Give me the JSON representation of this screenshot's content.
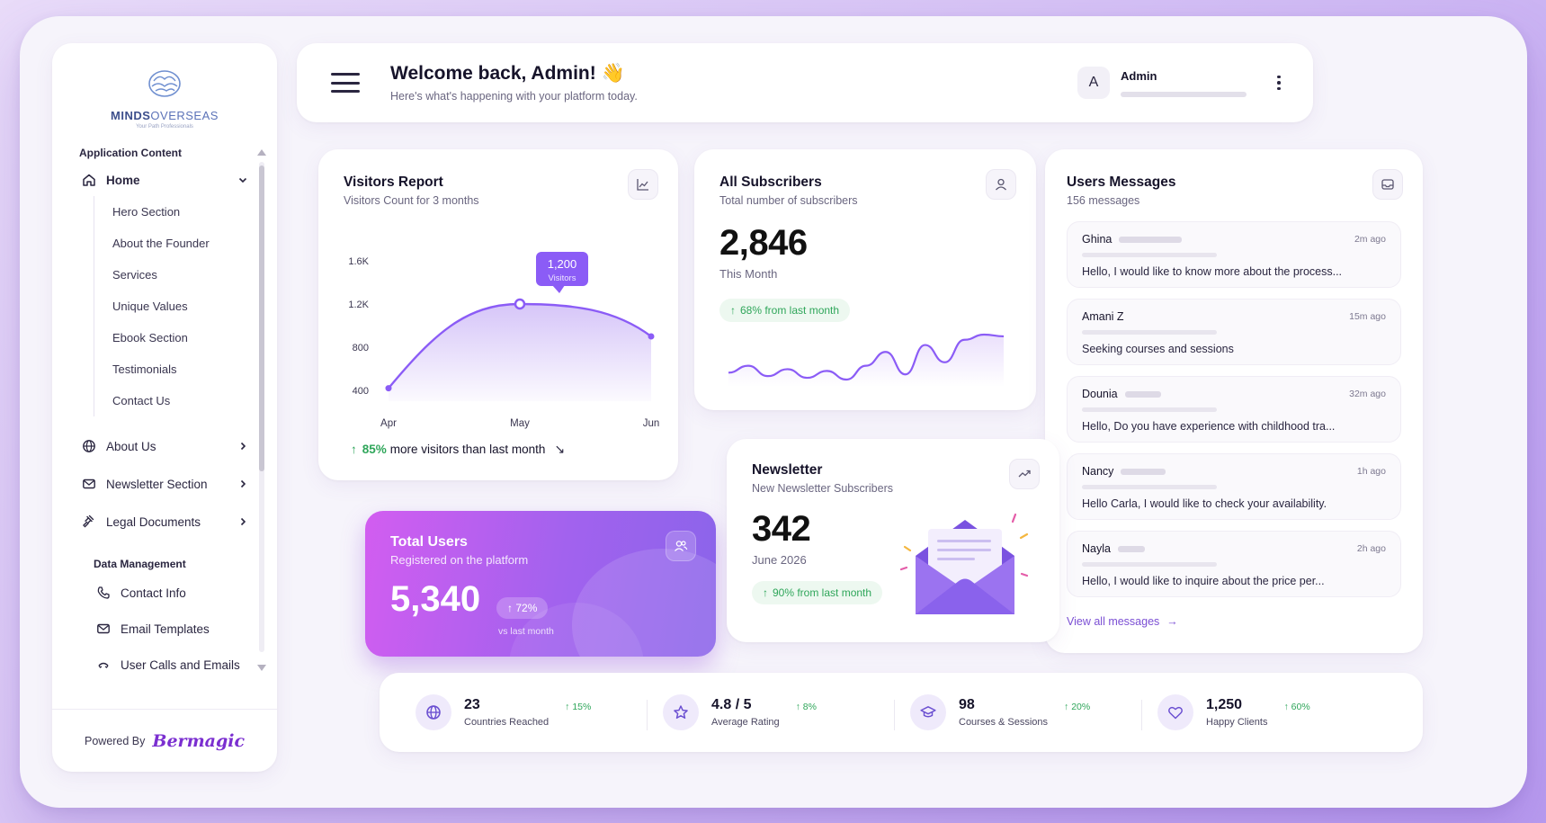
{
  "brand": {
    "name_part1": "MINDS",
    "name_part2": "OVERSEAS",
    "tagline": "Your Path Professionals"
  },
  "sidebar": {
    "section1_title": "Application Content",
    "home": {
      "label": "Home",
      "icon": "home-icon"
    },
    "home_children": [
      "Hero Section",
      "About the Founder",
      "Services",
      "Unique Values",
      "Ebook Section",
      "Testimonials",
      "Contact Us"
    ],
    "items": [
      {
        "label": "About Us",
        "icon": "globe-icon"
      },
      {
        "label": "Newsletter Section",
        "icon": "mail-icon"
      },
      {
        "label": "Legal Documents",
        "icon": "gavel-icon"
      }
    ],
    "section2_title": "Data Management",
    "data_items": [
      {
        "label": "Contact Info",
        "icon": "phone-icon"
      },
      {
        "label": "Email Templates",
        "icon": "mail-icon"
      },
      {
        "label": "User Calls and Emails",
        "icon": "phone-call-icon"
      }
    ],
    "powered_by": "Powered By",
    "powered_brand": "Bermagic"
  },
  "header": {
    "title": "Welcome back, Admin! 👋",
    "subtitle": "Here's what's happening with your platform today.",
    "user_initial": "A",
    "user_name": "Admin"
  },
  "visitors": {
    "title": "Visitors Report",
    "subtitle": "Visitors Count for 3 months",
    "tooltip_value": "1,200",
    "tooltip_label": "Visitors",
    "footer_pct": "85%",
    "footer_text": "more visitors than last month"
  },
  "chart_data": {
    "type": "area",
    "x": [
      "Apr",
      "May",
      "Jun"
    ],
    "series": [
      {
        "values": [
          420,
          1200,
          900
        ]
      }
    ],
    "xlabel": "",
    "ylabel": "",
    "yticks": [
      "1.6K",
      "1.2K",
      "800",
      "400"
    ],
    "ylim": [
      300,
      1700
    ],
    "grid": false,
    "highlight": {
      "x": "May",
      "value": 1200
    }
  },
  "subscribers": {
    "title": "All Subscribers",
    "subtitle": "Total number of subscribers",
    "value": "2,846",
    "caption": "This Month",
    "change": "68% from last month",
    "sparkline": [
      14,
      18,
      12,
      16,
      11,
      15,
      10,
      18,
      26,
      13,
      30,
      20,
      33,
      36,
      35
    ]
  },
  "messages": {
    "title": "Users Messages",
    "subtitle": "156 messages",
    "items": [
      {
        "name": "Ghina",
        "time": "2m ago",
        "text": "Hello, I would like to know more about the process..."
      },
      {
        "name": "Amani Z",
        "time": "15m ago",
        "text": "Seeking courses and sessions"
      },
      {
        "name": "Dounia",
        "time": "32m ago",
        "text": "Hello, Do you have experience with childhood tra..."
      },
      {
        "name": "Nancy",
        "time": "1h ago",
        "text": "Hello Carla, I would like to check your availability."
      },
      {
        "name": "Nayla",
        "time": "2h ago",
        "text": "Hello, I would like to inquire about the price per..."
      }
    ],
    "view_all": "View all messages"
  },
  "total_users": {
    "title": "Total Users",
    "subtitle": "Registered on the platform",
    "value": "5,340",
    "change": "72%",
    "vs": "vs last month"
  },
  "newsletter": {
    "title": "Newsletter",
    "subtitle": "New Newsletter Subscribers",
    "value": "342",
    "caption": "June 2026",
    "change": "90% from last month"
  },
  "stats": [
    {
      "value": "23",
      "label": "Countries Reached",
      "change": "15%",
      "icon": "globe-icon"
    },
    {
      "value": "4.8 / 5",
      "label": "Average Rating",
      "change": "8%",
      "icon": "star-icon"
    },
    {
      "value": "98",
      "label": "Courses & Sessions",
      "change": "20%",
      "icon": "graduation-cap-icon"
    },
    {
      "value": "1,250",
      "label": "Happy Clients",
      "change": "60%",
      "icon": "heart-icon"
    }
  ],
  "colors": {
    "accent": "#8b5cf6",
    "positive": "#2fa65a",
    "gradient_start": "#d25df0",
    "gradient_end": "#8a64ea"
  }
}
